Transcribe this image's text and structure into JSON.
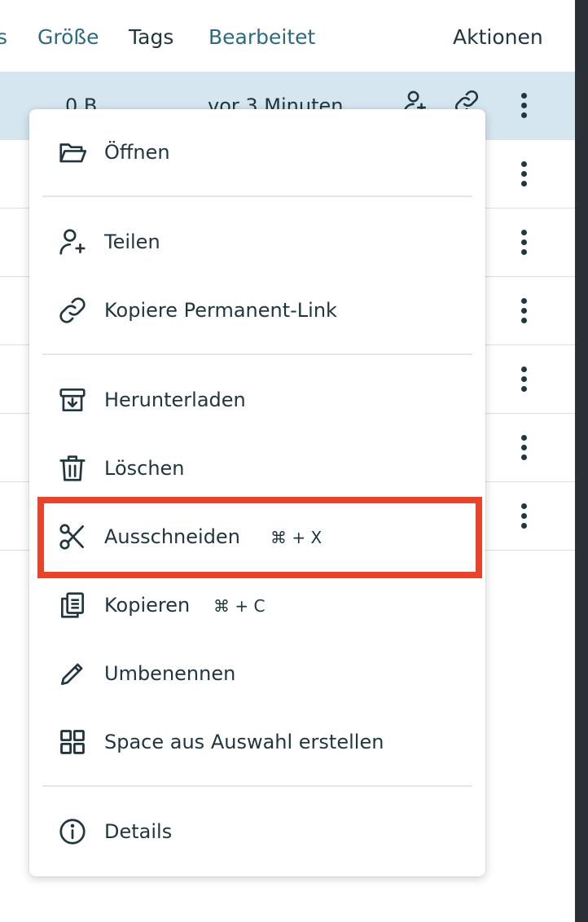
{
  "header": {
    "truncated_col": "s",
    "size_col": "Größe",
    "tags_col": "Tags",
    "modified_col": "Bearbeitet",
    "actions_col": "Aktionen"
  },
  "rows": [
    {
      "size": "0 B",
      "modified": "vor 3 Minuten"
    }
  ],
  "menu": {
    "open": "Öffnen",
    "share": "Teilen",
    "permalink": "Kopiere Permanent-Link",
    "download": "Herunterladen",
    "delete": "Löschen",
    "cut": "Ausschneiden",
    "cut_shortcut": "⌘ + X",
    "copy": "Kopieren",
    "copy_shortcut": "⌘ + C",
    "rename": "Umbenennen",
    "create_space": "Space aus Auswahl erstellen",
    "details": "Details"
  },
  "colors": {
    "accent_text": "#2e6a7f",
    "icon": "#21363f",
    "selected_row": "#d5e6f0",
    "highlight_border": "#e8442b"
  }
}
